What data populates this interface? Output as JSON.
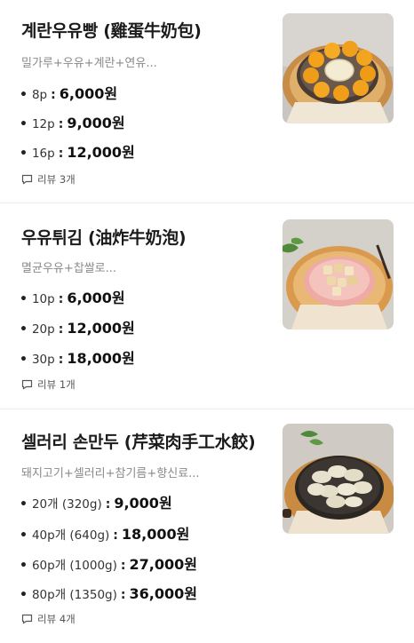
{
  "menu": [
    {
      "title": "계란우유빵 (雞蛋牛奶包)",
      "description": "밀가루+우유+계란+연유...",
      "options": [
        {
          "option": "8p",
          "price": "6,000원"
        },
        {
          "option": "12p",
          "price": "9,000원"
        },
        {
          "option": "16p",
          "price": "12,000원"
        }
      ],
      "review_label": "리뷰 3개",
      "image_icon": "egg-milk-bread-photo"
    },
    {
      "title": "우유튀김 (油炸牛奶泡)",
      "description": "멸균우유+찹쌀로...",
      "options": [
        {
          "option": "10p",
          "price": "6,000원"
        },
        {
          "option": "20p",
          "price": "12,000원"
        },
        {
          "option": "30p",
          "price": "18,000원"
        }
      ],
      "review_label": "리뷰 1개",
      "image_icon": "fried-milk-photo"
    },
    {
      "title": "셀러리 손만두 (芹菜肉手工水餃)",
      "description": "돼지고기+셀러리+참기름+향신료...",
      "options": [
        {
          "option": "20개 (320g)",
          "price": "9,000원"
        },
        {
          "option": "40p개 (640g)",
          "price": "18,000원"
        },
        {
          "option": "60p개 (1000g)",
          "price": "27,000원"
        },
        {
          "option": "80p개 (1350g)",
          "price": "36,000원"
        }
      ],
      "review_label": "리뷰 4개",
      "image_icon": "celery-dumpling-photo"
    }
  ],
  "colors": {
    "text_primary": "#1b1b1b",
    "text_secondary": "#8a8a8a",
    "divider": "#ececec"
  }
}
